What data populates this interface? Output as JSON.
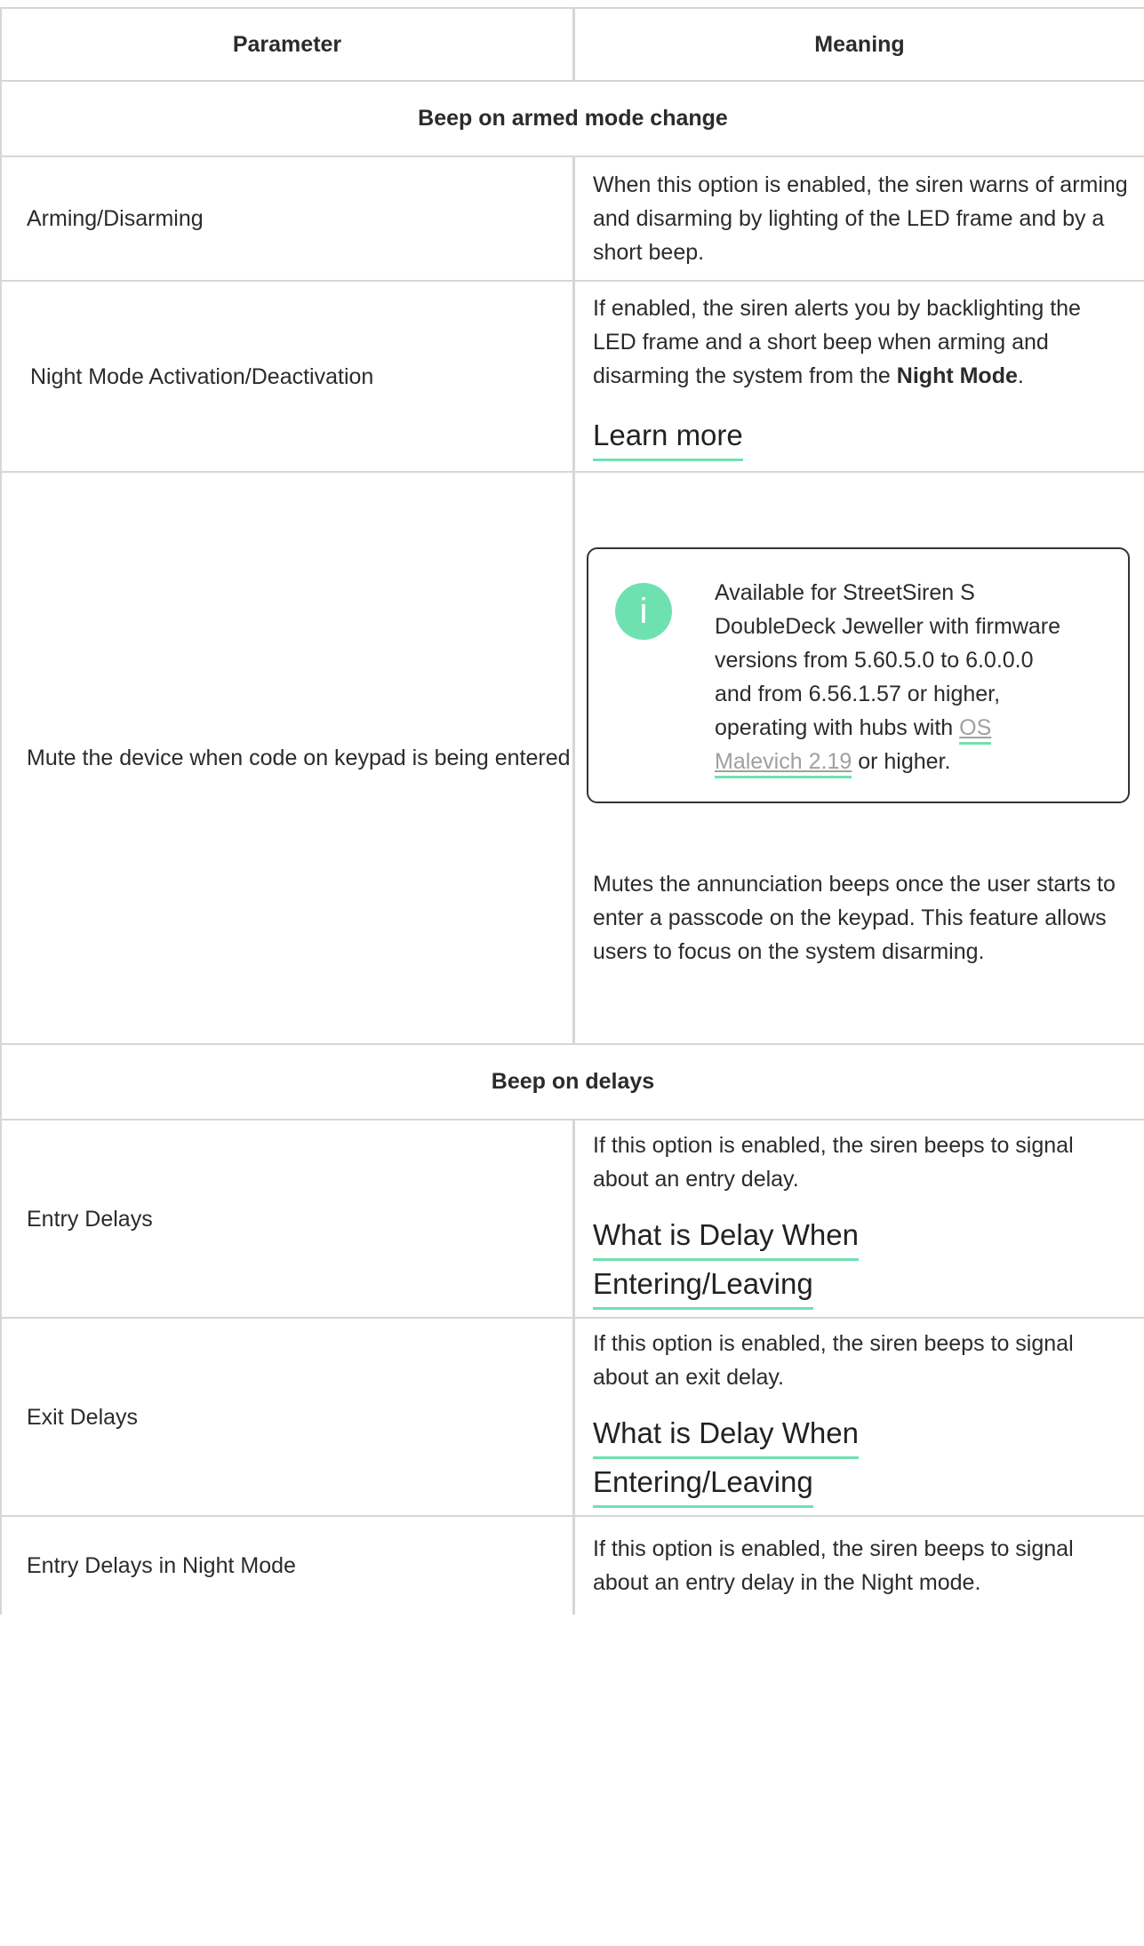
{
  "header": {
    "param": "Parameter",
    "meaning": "Meaning"
  },
  "sections": {
    "armed": "Beep on armed mode change",
    "delays": "Beep on delays"
  },
  "rows": {
    "arming": {
      "param": "Arming/Disarming",
      "meaning": "When this option is enabled, the siren warns of arming and disarming by lighting of the LED frame and by a short beep."
    },
    "night": {
      "param": "Night Mode Activation/Deactivation",
      "meaning_pre": "If enabled, the siren alerts you by backlighting the LED frame and a short beep when arming and disarming the system from the ",
      "meaning_bold": "Night Mode",
      "meaning_post": ".",
      "link": "Learn more"
    },
    "mute": {
      "param": "Mute the device when code on keypad is being entered",
      "callout_pre": "Available for StreetSiren S DoubleDeck Jeweller with firmware versions from 5.60.5.0 to 6.0.0.0 and from 6.56.1.57 or higher, operating with hubs with ",
      "callout_link": "OS Malevich 2.19",
      "callout_post": " or higher.",
      "meaning": "Mutes the annunciation beeps once the user starts to enter a passcode on the keypad. This feature allows users to focus on the system disarming."
    },
    "entry": {
      "param": "Entry Delays",
      "meaning": "If this option is enabled, the siren beeps to signal about an entry delay.",
      "link_line1": "What is Delay When",
      "link_line2": "Entering/Leaving"
    },
    "exit": {
      "param": "Exit Delays",
      "meaning": "If this option is enabled, the siren beeps to signal about an exit delay.",
      "link_line1": "What is Delay When",
      "link_line2": "Entering/Leaving"
    },
    "entry_night": {
      "param": "Entry Delays in Night Mode",
      "meaning": "If this option is enabled, the siren beeps to signal about an entry delay in the Night mode."
    }
  },
  "colors": {
    "accent": "#6fe1b1",
    "border": "#d6d6d6",
    "text": "#2b2b2b",
    "muted_link": "#a0a0a0"
  }
}
